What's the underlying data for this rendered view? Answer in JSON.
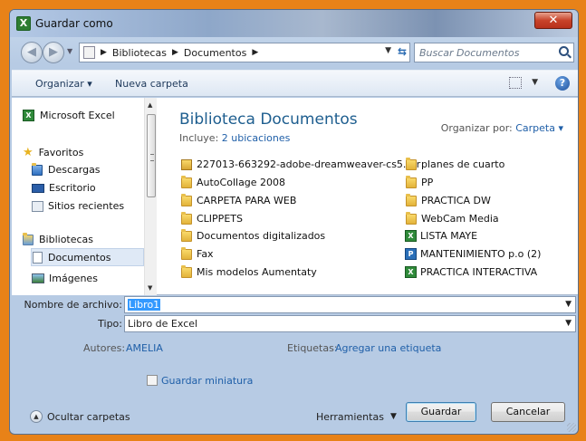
{
  "window": {
    "title": "Guardar como"
  },
  "address": {
    "crumbs": [
      "Bibliotecas",
      "Documentos"
    ]
  },
  "search": {
    "placeholder": "Buscar Documentos"
  },
  "toolbar": {
    "organize": "Organizar ▾",
    "new_folder": "Nueva carpeta"
  },
  "nav": {
    "items": [
      {
        "label": "Microsoft Excel"
      },
      {
        "label": "Favoritos"
      },
      {
        "label": "Descargas"
      },
      {
        "label": "Escritorio"
      },
      {
        "label": "Sitios recientes"
      },
      {
        "label": "Bibliotecas"
      },
      {
        "label": "Documentos"
      },
      {
        "label": "Imágenes"
      }
    ]
  },
  "library": {
    "title": "Biblioteca Documentos",
    "includes_prefix": "Incluye:",
    "includes_link": "2 ubicaciones",
    "arrange_label": "Organizar por:",
    "arrange_value": "Carpeta ▾"
  },
  "files_left": [
    "227013-663292-adobe-dreamweaver-cs5.rar",
    "AutoCollage 2008",
    "CARPETA PARA WEB",
    "CLIPPETS",
    "Documentos digitalizados",
    "Fax",
    "Mis modelos Aumentaty"
  ],
  "files_right": [
    "planes de cuarto",
    "PP",
    "PRACTICA DW",
    "WebCam Media",
    "LISTA MAYE",
    "MANTENIMIENTO p.o (2)",
    "PRACTICA INTERACTIVA"
  ],
  "form": {
    "filename_label": "Nombre de archivo:",
    "filename_value": "Libro1",
    "type_label": "Tipo:",
    "type_value": "Libro de Excel",
    "authors_label": "Autores:",
    "authors_value": "AMELIA",
    "tags_label": "Etiquetas:",
    "tags_value": "Agregar una etiqueta",
    "thumbnail_label": "Guardar miniatura"
  },
  "footer": {
    "hide_folders": "Ocultar carpetas",
    "tools": "Herramientas",
    "save": "Guardar",
    "cancel": "Cancelar"
  }
}
